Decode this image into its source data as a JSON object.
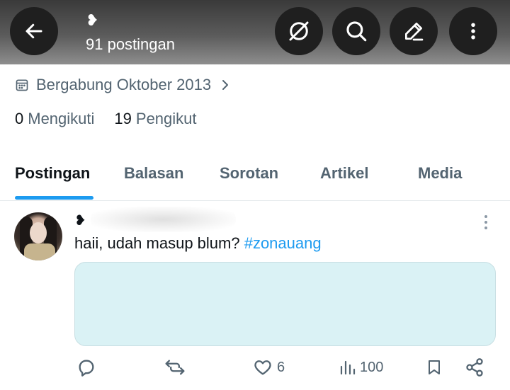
{
  "header": {
    "name_emoji": "❥",
    "post_count_label": "91 postingan"
  },
  "profile": {
    "joined_label": "Bergabung Oktober 2013",
    "following_count": "0",
    "following_label": "Mengikuti",
    "followers_count": "19",
    "followers_label": "Pengikut"
  },
  "tabs": [
    {
      "label": "Postingan",
      "active": true
    },
    {
      "label": "Balasan",
      "active": false
    },
    {
      "label": "Sorotan",
      "active": false
    },
    {
      "label": "Artikel",
      "active": false
    },
    {
      "label": "Media",
      "active": false
    }
  ],
  "post": {
    "name_emoji": "❥",
    "text": "haii, udah masup blum? ",
    "hashtag": "#zonauang",
    "likes": "6",
    "views": "100"
  },
  "colors": {
    "accent": "#1d9bf0",
    "secondary_text": "#536471",
    "media_card": "#daf2f5"
  },
  "icons": [
    "back-arrow-icon",
    "grok-icon",
    "search-icon",
    "compose-icon",
    "more-vertical-icon",
    "calendar-icon",
    "chevron-right-icon",
    "reply-icon",
    "repost-icon",
    "like-icon",
    "views-icon",
    "bookmark-icon",
    "share-icon"
  ]
}
